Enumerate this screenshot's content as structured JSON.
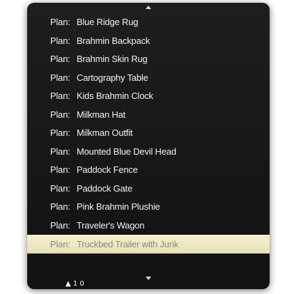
{
  "menu": {
    "items": [
      {
        "prefix": "Plan:",
        "label": "Blue Ridge Rug",
        "enabled": true
      },
      {
        "prefix": "Plan:",
        "label": "Brahmin Backpack",
        "enabled": true
      },
      {
        "prefix": "Plan:",
        "label": "Brahmin Skin Rug",
        "enabled": true
      },
      {
        "prefix": "Plan:",
        "label": "Cartography Table",
        "enabled": true
      },
      {
        "prefix": "Plan:",
        "label": "Kids Brahmin Clock",
        "enabled": true
      },
      {
        "prefix": "Plan:",
        "label": "Milkman Hat",
        "enabled": true
      },
      {
        "prefix": "Plan:",
        "label": "Milkman Outfit",
        "enabled": true
      },
      {
        "prefix": "Plan:",
        "label": "Mounted Blue Devil Head",
        "enabled": true
      },
      {
        "prefix": "Plan:",
        "label": "Paddock Fence",
        "enabled": true
      },
      {
        "prefix": "Plan:",
        "label": "Paddock Gate",
        "enabled": true
      },
      {
        "prefix": "Plan:",
        "label": "Pink Brahmin Plushie",
        "enabled": true
      },
      {
        "prefix": "Plan:",
        "label": "Traveler's Wagon",
        "enabled": true
      },
      {
        "prefix": "Plan:",
        "label": "Truckbed Trailer with Junk",
        "enabled": false,
        "highlighted": true
      }
    ],
    "cursor_glyph": "▲ 1 0"
  }
}
